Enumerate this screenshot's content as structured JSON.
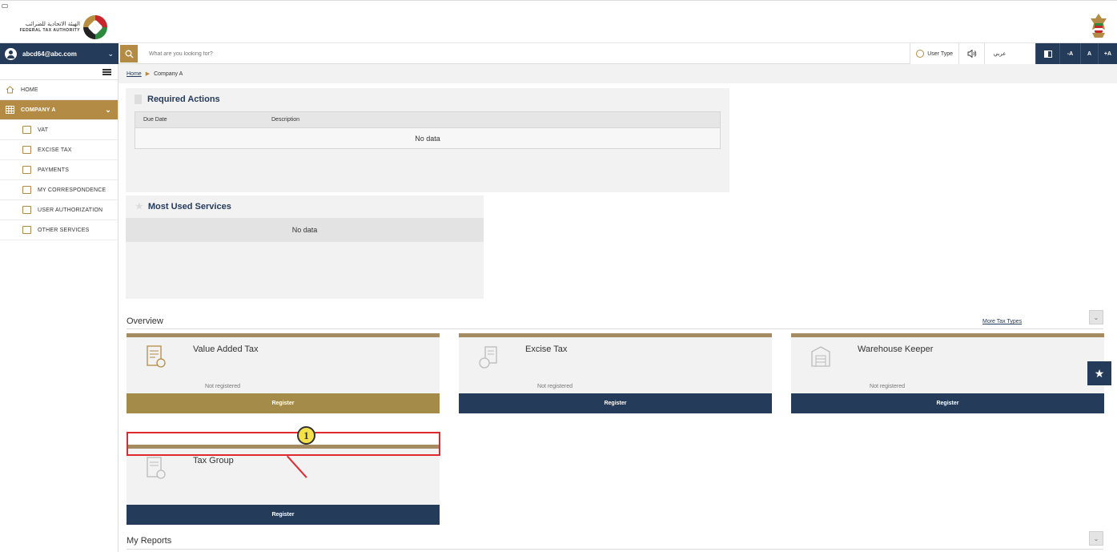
{
  "header": {
    "logo_arabic": "الهيئة الاتحادية للضرائب",
    "logo_english": "FEDERAL TAX AUTHORITY"
  },
  "navbar": {
    "user_email": "abcd64@abc.com",
    "search_placeholder": "What are you looking for?",
    "user_type_label": "User Type",
    "language_label": "عربي",
    "font_decrease": "-A",
    "font_normal": "A",
    "font_increase": "+A"
  },
  "sidebar": {
    "items": [
      {
        "label": "HOME",
        "icon": "home-icon"
      },
      {
        "label": "COMPANY A",
        "icon": "grid-icon"
      },
      {
        "label": "VAT",
        "icon": "vat-icon"
      },
      {
        "label": "EXCISE TAX",
        "icon": "excise-icon"
      },
      {
        "label": "PAYMENTS",
        "icon": "payments-icon"
      },
      {
        "label": "MY CORRESPONDENCE",
        "icon": "correspondence-icon"
      },
      {
        "label": "USER AUTHORIZATION",
        "icon": "user-authorization-icon"
      },
      {
        "label": "OTHER SERVICES",
        "icon": "other-services-icon"
      }
    ]
  },
  "breadcrumb": {
    "home": "Home",
    "current": "Company A"
  },
  "required_actions": {
    "title": "Required Actions",
    "columns": [
      "Due Date",
      "Description"
    ],
    "empty_text": "No data"
  },
  "most_used": {
    "title": "Most Used Services",
    "empty_text": "No data"
  },
  "overview": {
    "title": "Overview",
    "more_link": "More Tax Types",
    "cards": [
      {
        "title": "Value Added Tax",
        "status": "Not registered",
        "button": "Register"
      },
      {
        "title": "Excise Tax",
        "status": "Not registered",
        "button": "Register"
      },
      {
        "title": "Warehouse Keeper",
        "status": "Not registered",
        "button": "Register"
      },
      {
        "title": "Tax Group",
        "status": "",
        "button": "Register"
      }
    ]
  },
  "callout_number": "1",
  "my_reports": {
    "title": "My Reports"
  },
  "colors": {
    "navy": "#243b5a",
    "gold": "#b38b45",
    "highlight_red": "#e0282f"
  }
}
